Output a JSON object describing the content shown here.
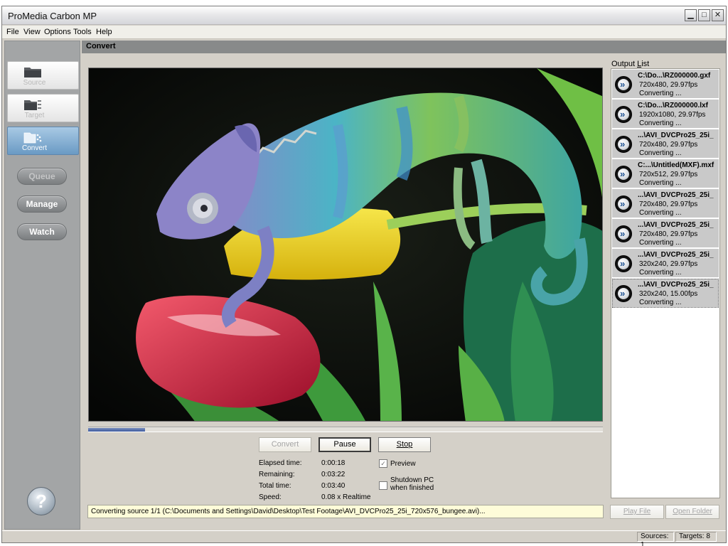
{
  "window": {
    "title": "ProMedia Carbon MP",
    "controls": {
      "minimize": "▁",
      "maximize": "□",
      "close": "✕"
    }
  },
  "menu": [
    "File",
    "View",
    "Options",
    "Tools",
    "Help"
  ],
  "sidebar": {
    "tabs": [
      {
        "label": "Source",
        "icon": "folder-icon",
        "active": false
      },
      {
        "label": "Target",
        "icon": "folder-export-icon",
        "active": false
      },
      {
        "label": "Convert",
        "icon": "convert-icon",
        "active": true
      }
    ],
    "buttons": [
      {
        "label": "Queue",
        "enabled": false
      },
      {
        "label": "Manage",
        "enabled": true
      },
      {
        "label": "Watch",
        "enabled": true
      }
    ],
    "help": "?"
  },
  "content": {
    "title": "Convert"
  },
  "preview": {
    "description": "chameleon-on-tulips-image"
  },
  "progress": {
    "fraction": 0.11
  },
  "controls": {
    "convert": "Convert",
    "pause": "Pause",
    "stop": "Stop"
  },
  "stats": [
    {
      "label": "Elapsed time:",
      "value": "0:00:18"
    },
    {
      "label": "Remaining:",
      "value": "0:03:22"
    },
    {
      "label": "Total time:",
      "value": "0:03:40"
    },
    {
      "label": "Speed:",
      "value": "0.08 x Realtime"
    }
  ],
  "options": {
    "preview": {
      "label": "Preview",
      "checked": true
    },
    "shutdown": {
      "line1": "Shutdown PC",
      "line2": "when finished",
      "checked": false
    }
  },
  "status_line": "Converting source 1/1 (C:\\Documents and Settings\\David\\Desktop\\Test Footage\\AVI_DVCPro25_25i_720x576_bungee.avi)...",
  "output": {
    "label": "Output List",
    "items": [
      {
        "name": "C:\\Do...\\RZ000000.gxf",
        "info": "720x480, 29.97fps",
        "status": "Converting ..."
      },
      {
        "name": "C:\\Do...\\RZ000000.lxf",
        "info": "1920x1080, 29.97fps",
        "status": "Converting ..."
      },
      {
        "name": "...\\AVI_DVCPro25_25i_",
        "info": "720x480, 29.97fps",
        "status": "Converting ..."
      },
      {
        "name": "C:...\\Untitled(MXF).mxf",
        "info": "720x512, 29.97fps",
        "status": "Converting ..."
      },
      {
        "name": "...\\AVI_DVCPro25_25i_",
        "info": "720x480, 29.97fps",
        "status": "Converting ..."
      },
      {
        "name": "...\\AVI_DVCPro25_25i_",
        "info": "720x480, 29.97fps",
        "status": "Converting ..."
      },
      {
        "name": "...\\AVI_DVCPro25_25i_",
        "info": "320x240, 29.97fps",
        "status": "Converting ..."
      },
      {
        "name": "...\\AVI_DVCPro25_25i_",
        "info": "320x240, 15.00fps",
        "status": "Converting ..."
      }
    ],
    "play_file": "Play File",
    "open_folder": "Open Folder"
  },
  "statusbar": {
    "sources": "Sources: 1",
    "targets": "Targets: 8"
  },
  "colors": {
    "active_tab": "#6a9ac4",
    "status_bg": "#fefcd9",
    "progress": "#3d5a9e"
  }
}
